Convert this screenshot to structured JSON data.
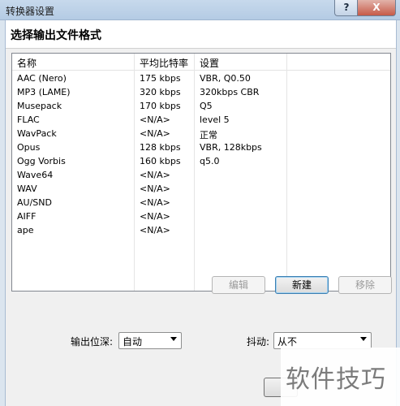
{
  "window": {
    "title": "转换器设置",
    "help_glyph": "?",
    "close_glyph": "X"
  },
  "heading": "选择输出文件格式",
  "list": {
    "columns": [
      "名称",
      "平均比特率",
      "设置"
    ],
    "rows": [
      [
        "AAC (Nero)",
        "175 kbps",
        "VBR, Q0.50"
      ],
      [
        "MP3 (LAME)",
        "320 kbps",
        "320kbps CBR"
      ],
      [
        "Musepack",
        "170 kbps",
        "Q5"
      ],
      [
        "FLAC",
        "<N/A>",
        "level 5"
      ],
      [
        "WavPack",
        "<N/A>",
        "正常"
      ],
      [
        "Opus",
        "128 kbps",
        "VBR, 128kbps"
      ],
      [
        "Ogg Vorbis",
        "160 kbps",
        "q5.0"
      ],
      [
        "Wave64",
        "<N/A>",
        ""
      ],
      [
        "WAV",
        "<N/A>",
        ""
      ],
      [
        "AU/SND",
        "<N/A>",
        ""
      ],
      [
        "AIFF",
        "<N/A>",
        ""
      ],
      [
        "ape",
        "<N/A>",
        ""
      ]
    ]
  },
  "buttons": {
    "edit": "编辑",
    "new": "新建",
    "remove": "移除"
  },
  "output_depth": {
    "label": "输出位深:",
    "value": "自动"
  },
  "dither": {
    "label": "抖动:",
    "value": "从不"
  },
  "watermark": "软件技巧"
}
